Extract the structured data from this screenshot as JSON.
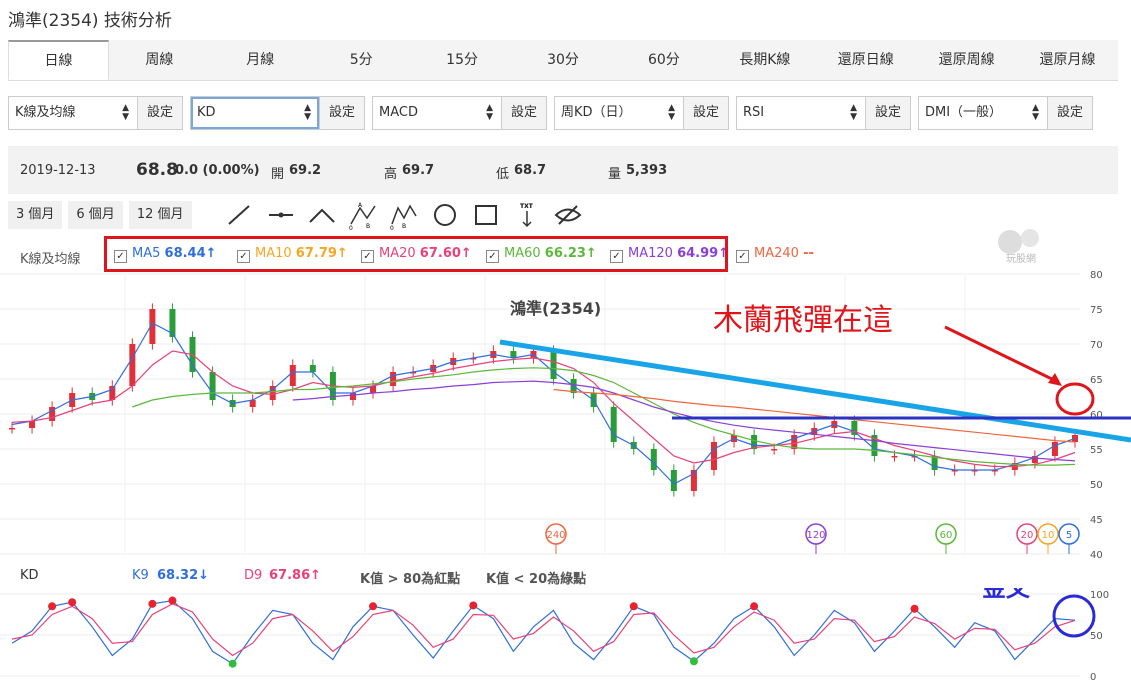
{
  "page": {
    "title": "鴻準(2354) 技術分析"
  },
  "tabs": [
    "日線",
    "周線",
    "月線",
    "5分",
    "15分",
    "30分",
    "60分",
    "長期K線",
    "還原日線",
    "還原周線",
    "還原月線"
  ],
  "selectors": [
    {
      "value": "K線及均線",
      "button": "設定"
    },
    {
      "value": "KD",
      "button": "設定"
    },
    {
      "value": "MACD",
      "button": "設定"
    },
    {
      "value": "周KD（日）",
      "button": "設定"
    },
    {
      "value": "RSI",
      "button": "設定"
    },
    {
      "value": "DMI（一般）",
      "button": "設定"
    }
  ],
  "quote": {
    "date": "2019-12-13",
    "price": "68.8",
    "change": "0.0 (0.00%)",
    "open_label": "開",
    "open": "69.2",
    "high_label": "高",
    "high": "69.7",
    "low_label": "低",
    "low": "68.7",
    "vol_label": "量",
    "vol": "5,393"
  },
  "periods": [
    "3 個月",
    "6 個月",
    "12 個月"
  ],
  "tool_icons": [
    "line-tool-icon",
    "horizontal-line-icon",
    "angle-line-icon",
    "abc-pattern-icon",
    "abcd-pattern-icon",
    "circle-tool-icon",
    "rectangle-tool-icon",
    "text-tool-icon",
    "hide-icon"
  ],
  "ma_label": "K線及均線",
  "ma": [
    {
      "name": "MA5",
      "value": "68.44↑",
      "color": "#2f6fdc"
    },
    {
      "name": "MA10",
      "value": "67.79↑",
      "color": "#f5a623"
    },
    {
      "name": "MA20",
      "value": "67.60↑",
      "color": "#e8427a"
    },
    {
      "name": "MA60",
      "value": "66.23↑",
      "color": "#5bb83a"
    },
    {
      "name": "MA120",
      "value": "64.99↑",
      "color": "#8b3fd6"
    },
    {
      "name": "MA240",
      "value": "--",
      "color": "#f06640"
    }
  ],
  "watermark": "玩股網",
  "kd": {
    "label": "KD",
    "k": "K9",
    "k_val": "68.32↓",
    "d": "D9",
    "d_val": "67.86↑",
    "note1": "K值 > 80為紅點",
    "note2": "K值 < 20為綠點"
  },
  "chart_data": [
    {
      "type": "line",
      "title": "鴻準(2354)",
      "ylim": [
        40,
        80
      ],
      "y_ticks": [
        40,
        45,
        50,
        55,
        60,
        65,
        70,
        75,
        80
      ],
      "grid": true,
      "series": [
        {
          "name": "Close",
          "values": [
            58,
            59,
            61,
            63,
            62,
            64,
            70,
            75,
            71,
            66,
            62,
            61,
            62,
            64,
            67,
            66,
            62,
            63,
            64,
            66,
            66,
            67,
            68,
            68,
            69,
            68,
            69,
            65,
            63,
            61,
            56,
            55,
            52,
            49,
            52,
            56,
            57,
            55,
            55,
            57,
            58,
            59,
            57,
            54,
            54,
            54,
            52,
            52,
            52,
            52,
            53,
            54,
            56,
            57
          ],
          "color": "#c8313b"
        },
        {
          "name": "MA5",
          "values": [
            58.5,
            59,
            60.5,
            62,
            62.5,
            63.5,
            68,
            73,
            71.5,
            67,
            63,
            61.5,
            62,
            63.5,
            66,
            66,
            63,
            63,
            64,
            65.5,
            66,
            66.5,
            67.5,
            68,
            68.5,
            68,
            68.5,
            66,
            64,
            62,
            57,
            55.5,
            53,
            50,
            51.5,
            55,
            56.5,
            55.5,
            55.5,
            56.5,
            57.5,
            58.5,
            57.5,
            55,
            54.5,
            54,
            52.5,
            52,
            52,
            52,
            52.8,
            53.8,
            55.5,
            56.5
          ],
          "color": "#2f6fdc"
        },
        {
          "name": "MA20",
          "values": [
            58.8,
            59,
            59.5,
            60.5,
            61.5,
            62,
            64,
            67,
            69,
            68.5,
            66,
            64,
            63,
            62.8,
            63.5,
            64.5,
            64,
            63.8,
            64,
            64.7,
            65.3,
            65.8,
            66.5,
            67,
            67.5,
            67.8,
            68,
            67.5,
            66.5,
            64.5,
            61.5,
            59,
            56.5,
            54,
            53,
            53.5,
            54.5,
            55.2,
            55.5,
            55.8,
            56.5,
            57.2,
            57.5,
            56.5,
            55.5,
            54.8,
            54,
            53.3,
            52.8,
            52.5,
            52.5,
            52.8,
            53.5,
            54.5
          ],
          "color": "#e8427a"
        },
        {
          "name": "MA60",
          "values": [
            null,
            null,
            null,
            null,
            null,
            null,
            61,
            62,
            62.5,
            62.8,
            63,
            63,
            63,
            63.2,
            63.5,
            63.5,
            63.8,
            64,
            64.3,
            64.6,
            65,
            65.3,
            65.6,
            66,
            66.3,
            66.5,
            66.6,
            66.5,
            66.2,
            65.5,
            64.5,
            63,
            61.5,
            60,
            58.8,
            57.8,
            57,
            56.2,
            55.6,
            55.2,
            55,
            55,
            55,
            54.8,
            54.5,
            54.2,
            53.8,
            53.5,
            53.2,
            53,
            52.8,
            52.7,
            52.7,
            52.8
          ],
          "color": "#5bb83a"
        },
        {
          "name": "MA120",
          "values": [
            null,
            null,
            null,
            null,
            null,
            null,
            null,
            null,
            null,
            null,
            null,
            null,
            null,
            null,
            62,
            62.2,
            62.5,
            62.7,
            63,
            63.2,
            63.5,
            63.7,
            64,
            64.2,
            64.5,
            64.6,
            64.7,
            64.5,
            64.2,
            63.8,
            63,
            62,
            61,
            60.2,
            59.5,
            58.9,
            58.4,
            58,
            57.7,
            57.4,
            57.1,
            56.8,
            56.5,
            56.2,
            55.8,
            55.5,
            55.2,
            54.9,
            54.6,
            54.3,
            54,
            53.7,
            53.5,
            53.3
          ],
          "color": "#8b3fd6"
        },
        {
          "name": "MA240",
          "values": [
            null,
            null,
            null,
            null,
            null,
            null,
            null,
            null,
            null,
            null,
            null,
            null,
            null,
            null,
            null,
            null,
            null,
            null,
            null,
            null,
            null,
            null,
            null,
            null,
            null,
            null,
            null,
            63.5,
            63.2,
            63,
            62.8,
            62.5,
            62.2,
            61.8,
            61.5,
            61.2,
            61,
            60.7,
            60.4,
            60.1,
            59.8,
            59.5,
            59.2,
            58.9,
            58.6,
            58.3,
            58,
            57.7,
            57.4,
            57.1,
            56.8,
            56.5,
            56.2,
            56
          ],
          "color": "#f06640"
        }
      ],
      "markers": [
        "240",
        "120",
        "60",
        "20",
        "10",
        "5"
      ],
      "annotations": [
        {
          "text": "木蘭飛彈在這",
          "color": "#e0151b"
        }
      ]
    },
    {
      "type": "line",
      "ylim": [
        0,
        100
      ],
      "y_ticks": [
        0,
        50,
        100
      ],
      "series": [
        {
          "name": "K9",
          "values": [
            40,
            55,
            85,
            90,
            60,
            25,
            45,
            88,
            92,
            70,
            30,
            15,
            50,
            80,
            75,
            40,
            20,
            60,
            85,
            80,
            50,
            22,
            55,
            86,
            70,
            30,
            60,
            80,
            40,
            20,
            50,
            85,
            75,
            35,
            18,
            40,
            70,
            85,
            60,
            25,
            50,
            80,
            65,
            30,
            55,
            82,
            60,
            35,
            65,
            55,
            20,
            45,
            70,
            68
          ],
          "color": "#2f6fdc"
        },
        {
          "name": "D9",
          "values": [
            45,
            50,
            75,
            85,
            70,
            40,
            42,
            75,
            88,
            78,
            45,
            25,
            40,
            70,
            75,
            55,
            30,
            48,
            75,
            80,
            62,
            35,
            45,
            75,
            74,
            45,
            52,
            72,
            55,
            30,
            42,
            75,
            77,
            50,
            28,
            35,
            60,
            78,
            68,
            40,
            45,
            70,
            68,
            42,
            48,
            72,
            64,
            45,
            58,
            57,
            32,
            40,
            60,
            67.86
          ],
          "color": "#e8427a"
        }
      ],
      "annotations": [
        {
          "text": "金叉",
          "color": "#2b2bd6"
        }
      ]
    }
  ]
}
